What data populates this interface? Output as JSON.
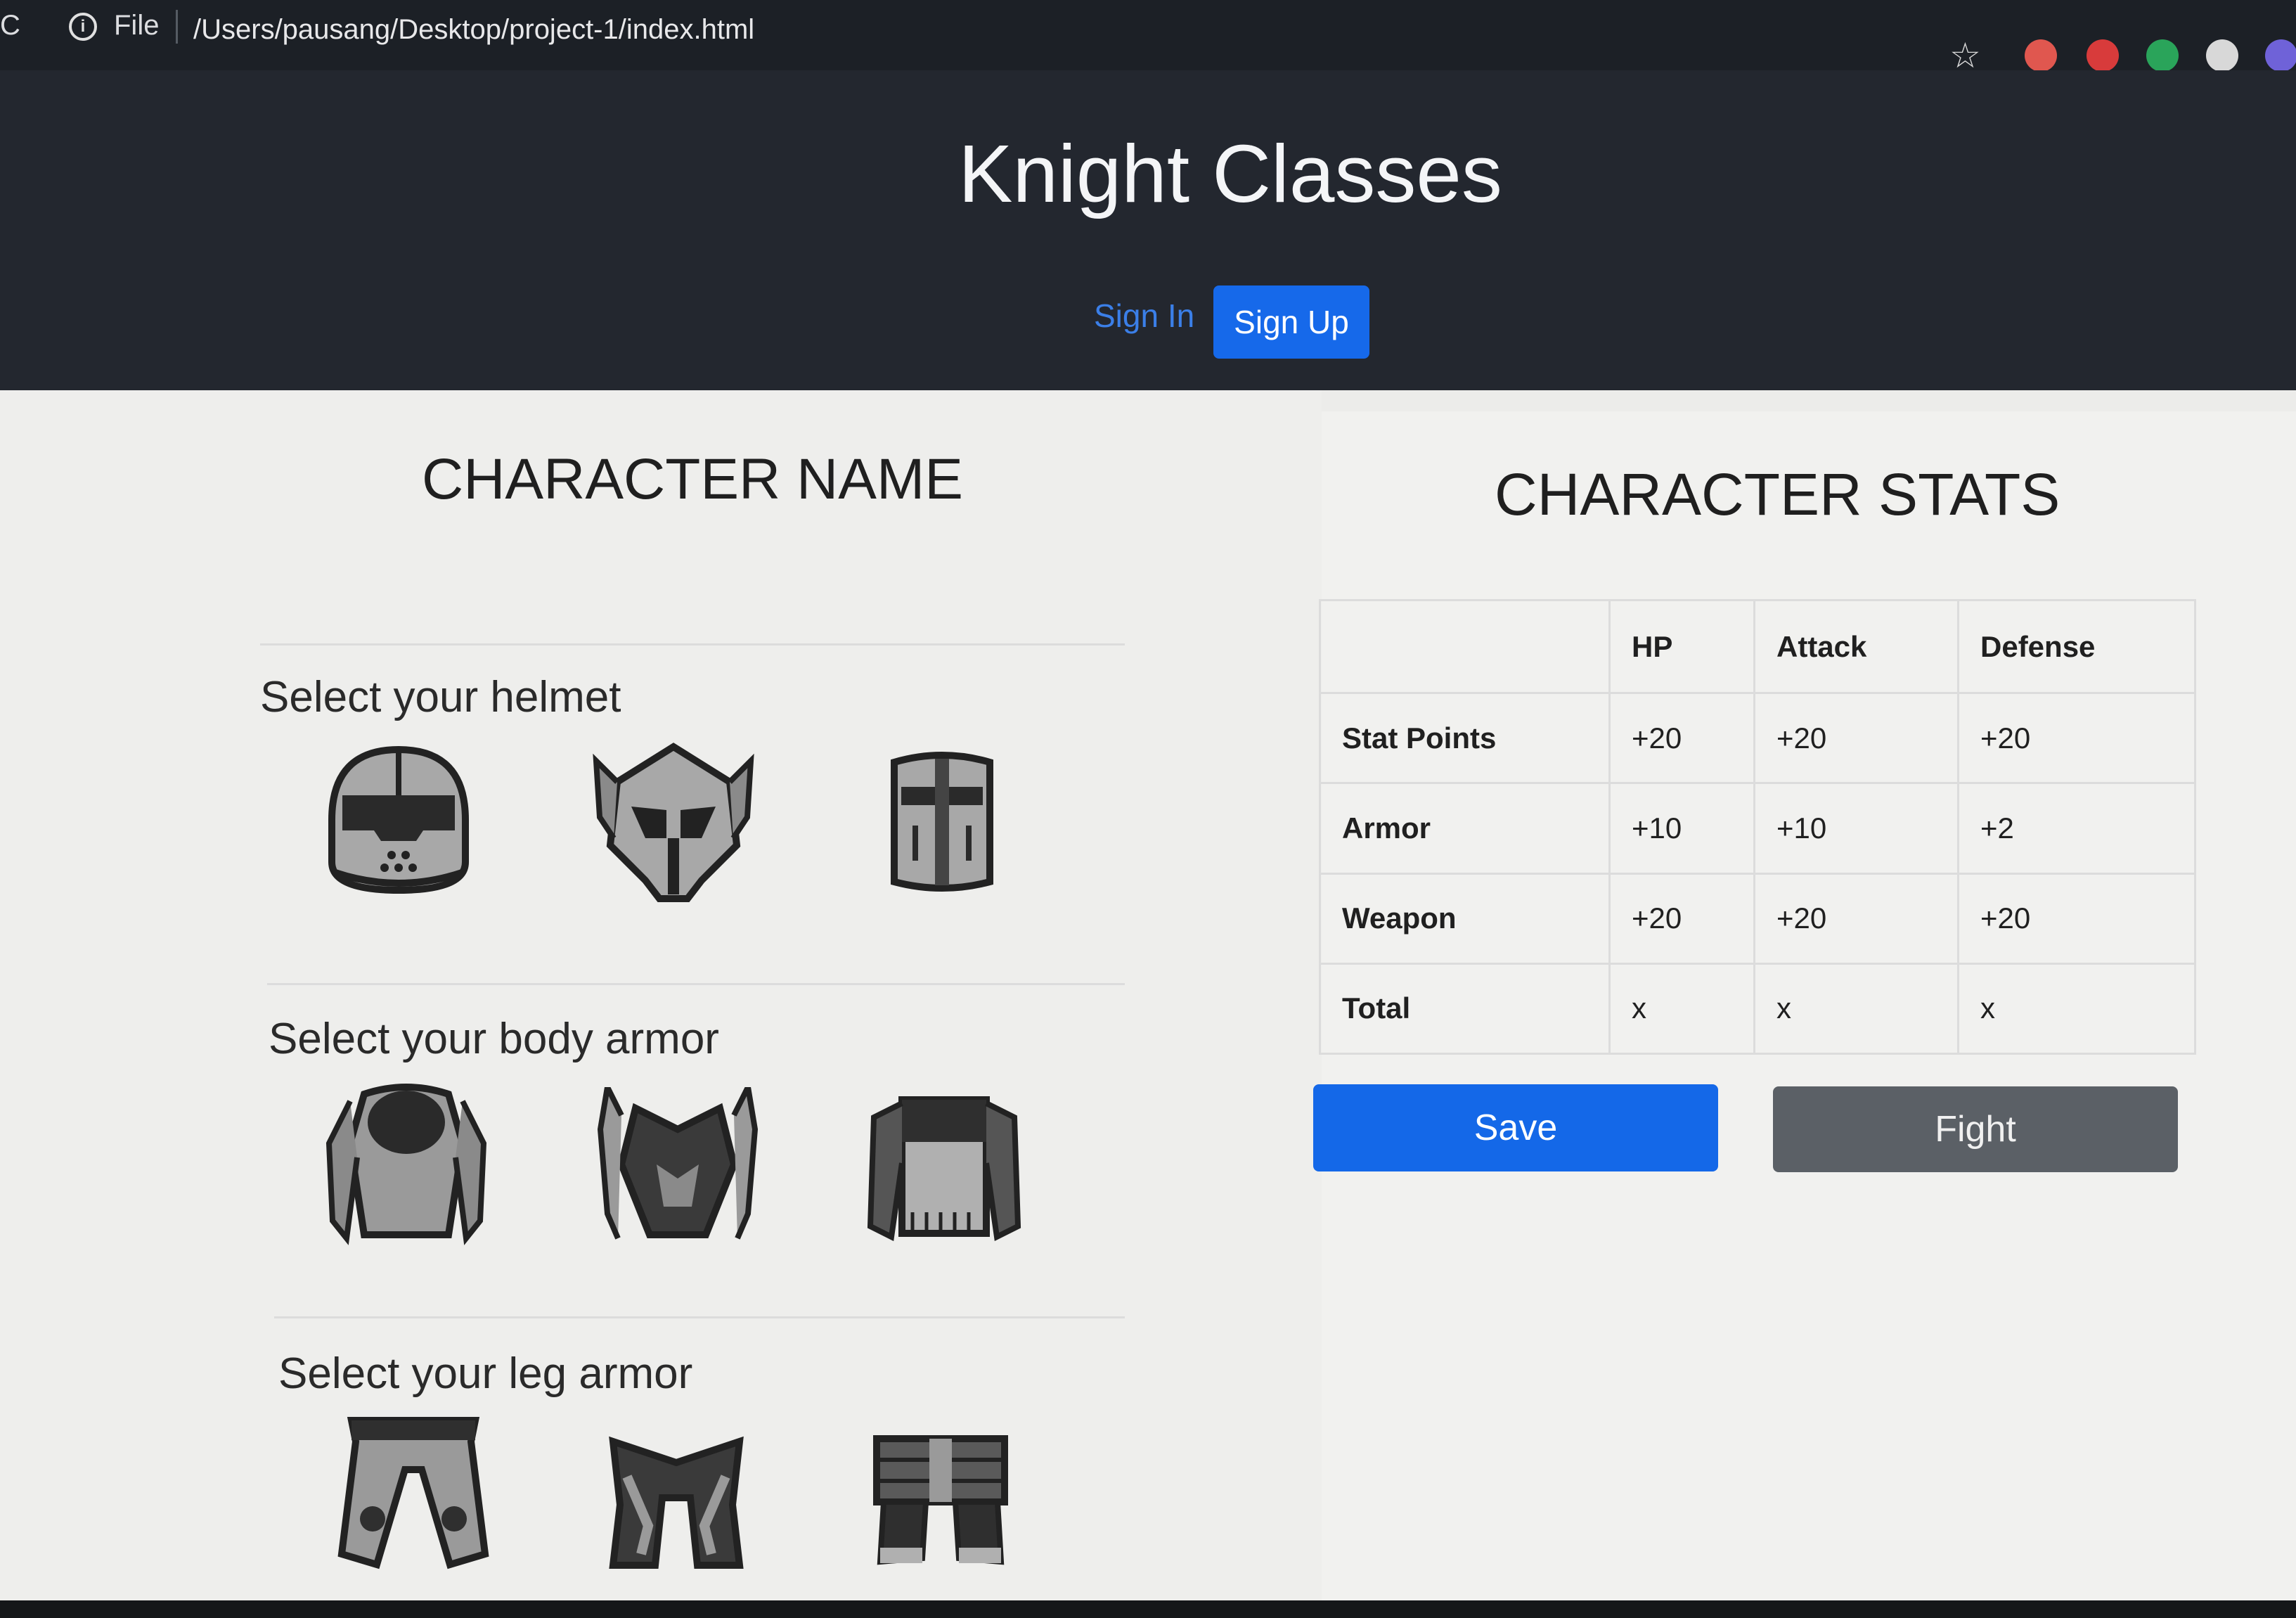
{
  "browser": {
    "reload_glyph": "C",
    "info_glyph": "i",
    "file_label": "File",
    "url": "/Users/pausang/Desktop/project-1/index.html",
    "star_glyph": "☆",
    "extensions": [
      {
        "name": "video-extension-icon",
        "color": "#e0574f"
      },
      {
        "name": "adblock-extension-icon",
        "color": "#d83b3b"
      },
      {
        "name": "grammarly-extension-icon",
        "color": "#2aa45a"
      },
      {
        "name": "circle-extension-icon",
        "color": "#d8d8d8"
      },
      {
        "name": "profile-extension-icon",
        "color": "#6f62d8"
      }
    ]
  },
  "header": {
    "title": "Knight Classes",
    "sign_in": "Sign In",
    "sign_up": "Sign Up"
  },
  "character": {
    "heading": "CHARACTER NAME",
    "sections": [
      {
        "label": "Select your helmet",
        "items": [
          "visor-helmet-icon",
          "horned-helmet-icon",
          "great-helm-icon"
        ]
      },
      {
        "label": "Select your body armor",
        "items": [
          "plate-armor-icon",
          "spiked-armor-icon",
          "chainmail-armor-icon"
        ]
      },
      {
        "label": "Select your leg armor",
        "items": [
          "plate-greaves-icon",
          "spiked-greaves-icon",
          "banded-greaves-icon"
        ]
      }
    ]
  },
  "stats": {
    "heading": "CHARACTER STATS",
    "columns": [
      "",
      "HP",
      "Attack",
      "Defense"
    ],
    "rows": [
      {
        "label": "Stat Points",
        "values": [
          "+20",
          "+20",
          "+20"
        ]
      },
      {
        "label": "Armor",
        "values": [
          "+10",
          "+10",
          "+2"
        ]
      },
      {
        "label": "Weapon",
        "values": [
          "+20",
          "+20",
          "+20"
        ]
      },
      {
        "label": "Total",
        "values": [
          "x",
          "x",
          "x"
        ]
      }
    ],
    "save": "Save",
    "fight": "Fight"
  },
  "colors": {
    "primary": "#1468e8",
    "secondary": "#5b6066",
    "header_bg": "#23272f"
  }
}
